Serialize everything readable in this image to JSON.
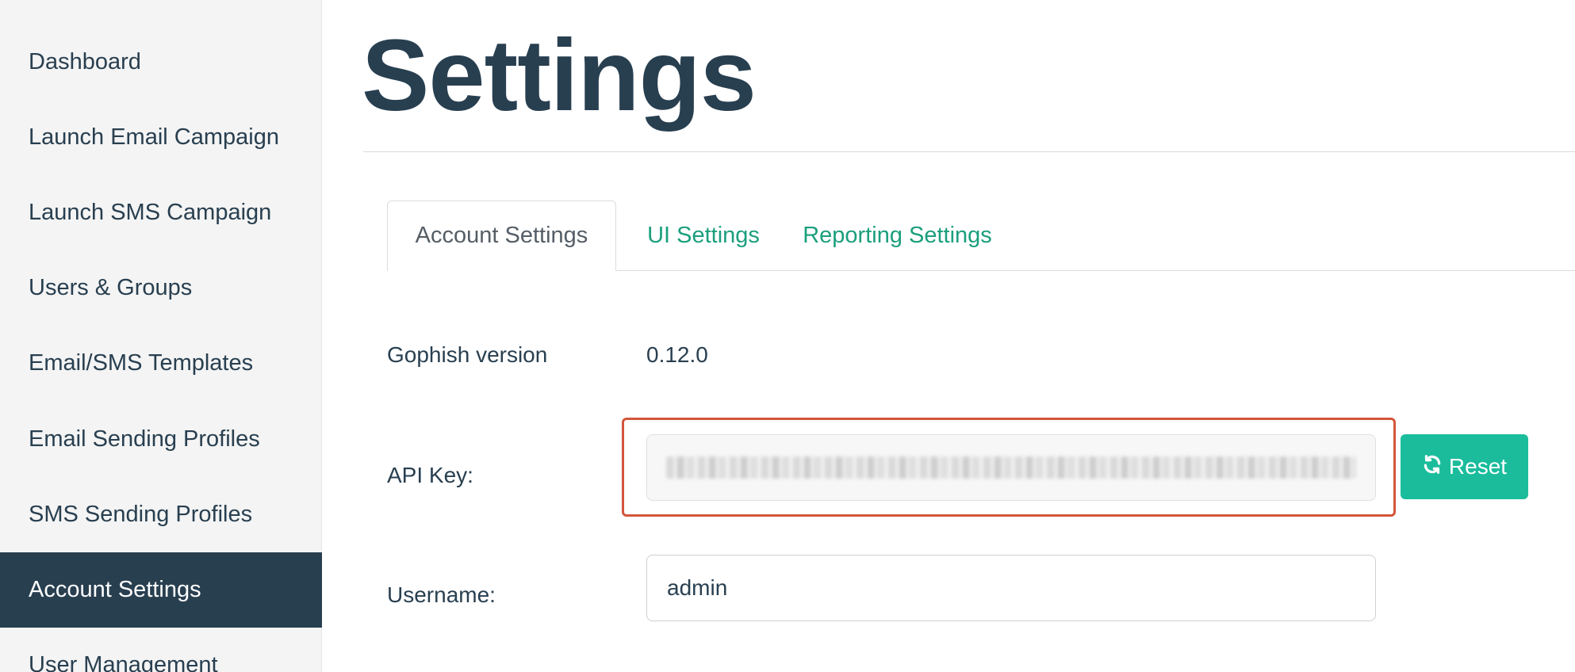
{
  "sidebar": {
    "items": [
      {
        "label": "Dashboard"
      },
      {
        "label": "Launch Email Campaign"
      },
      {
        "label": "Launch SMS Campaign"
      },
      {
        "label": "Users & Groups"
      },
      {
        "label": "Email/SMS Templates"
      },
      {
        "label": "Email Sending Profiles"
      },
      {
        "label": "SMS Sending Profiles"
      },
      {
        "label": "Account Settings",
        "active": true
      },
      {
        "label": "User Management"
      }
    ]
  },
  "page": {
    "title": "Settings"
  },
  "tabs": [
    {
      "label": "Account Settings",
      "active": true
    },
    {
      "label": "UI Settings"
    },
    {
      "label": "Reporting Settings"
    }
  ],
  "form": {
    "version_label": "Gophish version",
    "version_value": "0.12.0",
    "api_key_label": "API Key:",
    "reset_label": "Reset",
    "username_label": "Username:",
    "username_value": "admin"
  },
  "colors": {
    "primary_dark": "#283f50",
    "accent_teal": "#1abc9c",
    "tab_link": "#1b9f7d",
    "highlight": "#d4553a"
  }
}
